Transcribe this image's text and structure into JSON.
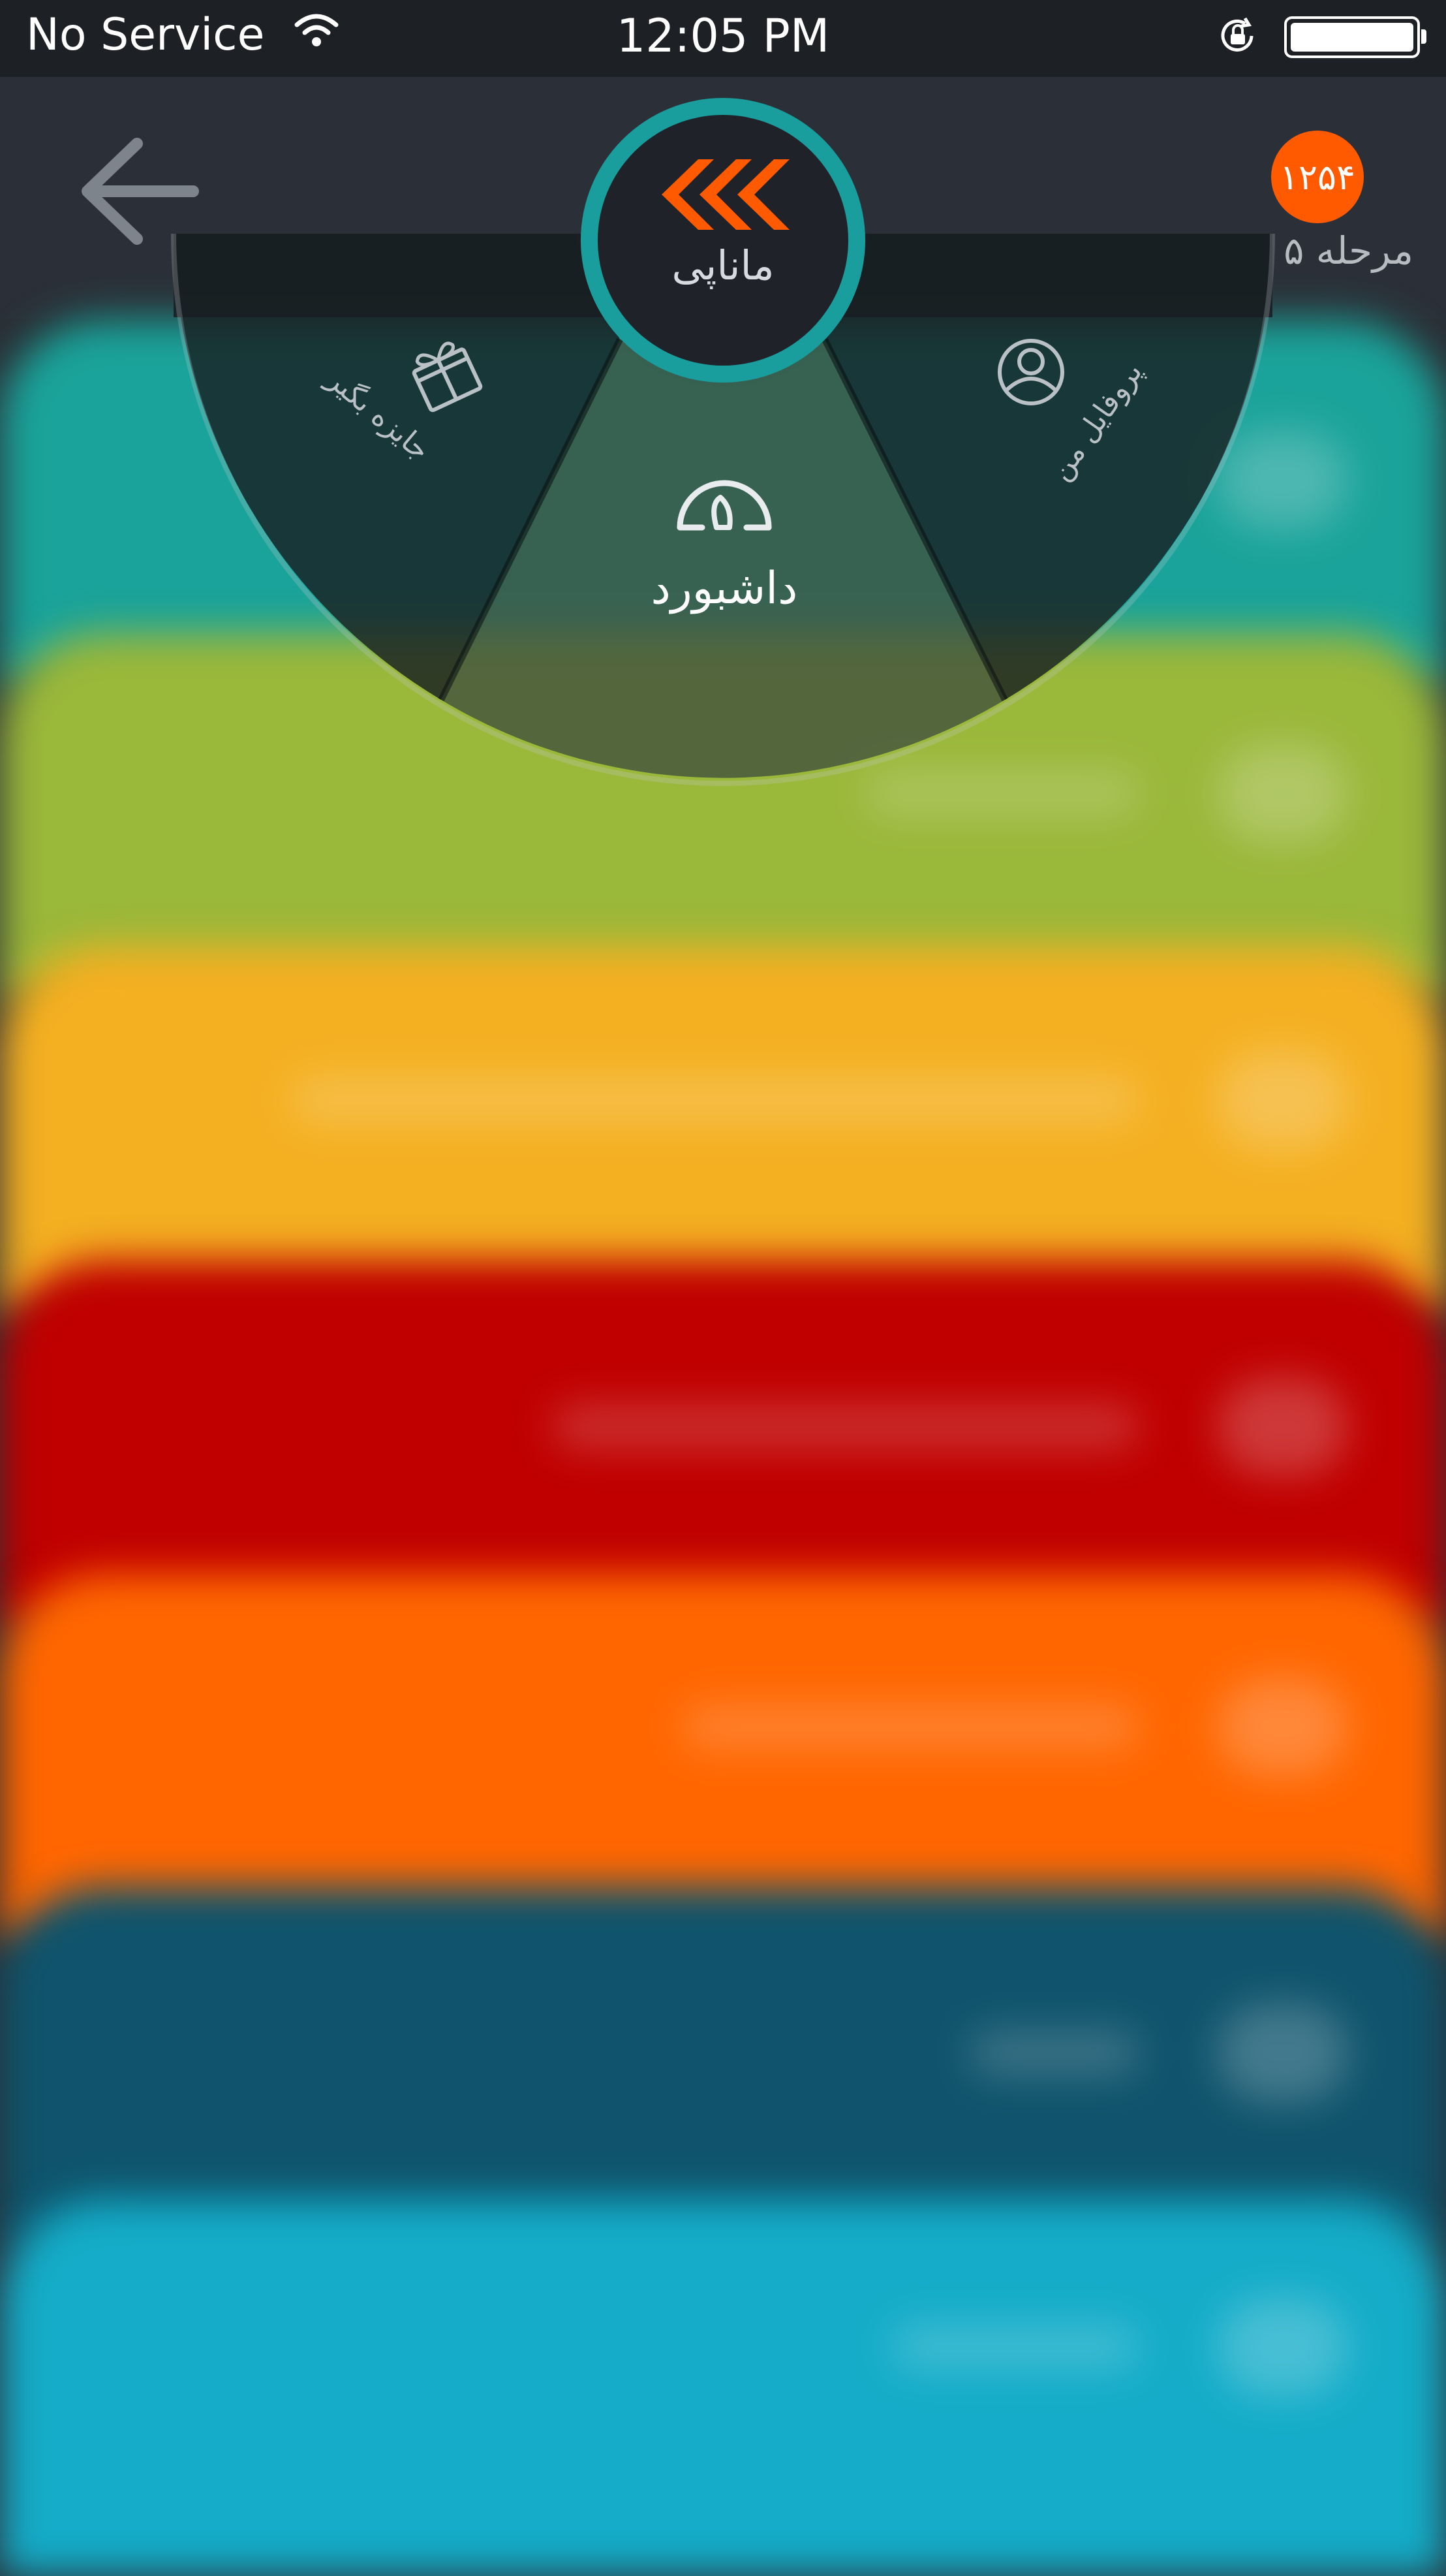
{
  "status_bar": {
    "carrier": "No Service",
    "time": "12:05 PM"
  },
  "header": {
    "level_number": "۱۲۵۴",
    "level_label": "مرحله ۵"
  },
  "radial_menu": {
    "brand_name": "ماناپی",
    "selected_item": "داشبورد",
    "left_item": "جایزه بگیر",
    "right_item": "پروفایل من"
  },
  "colors": {
    "accent": "#ff5a00",
    "teal": "#1a9e9d",
    "card_colors": [
      "#1aa39a",
      "#9ab83a",
      "#f4b021",
      "#c00000",
      "#ff6600",
      "#0f546c",
      "#14acc8"
    ]
  },
  "icons": {
    "back": "arrow-left-icon",
    "logo": "chevrons-left-icon",
    "dashboard": "gauge-icon",
    "gift": "gift-icon",
    "profile": "profile-icon",
    "wifi": "wifi-icon",
    "lock": "rotation-lock-icon",
    "battery": "battery-icon"
  }
}
